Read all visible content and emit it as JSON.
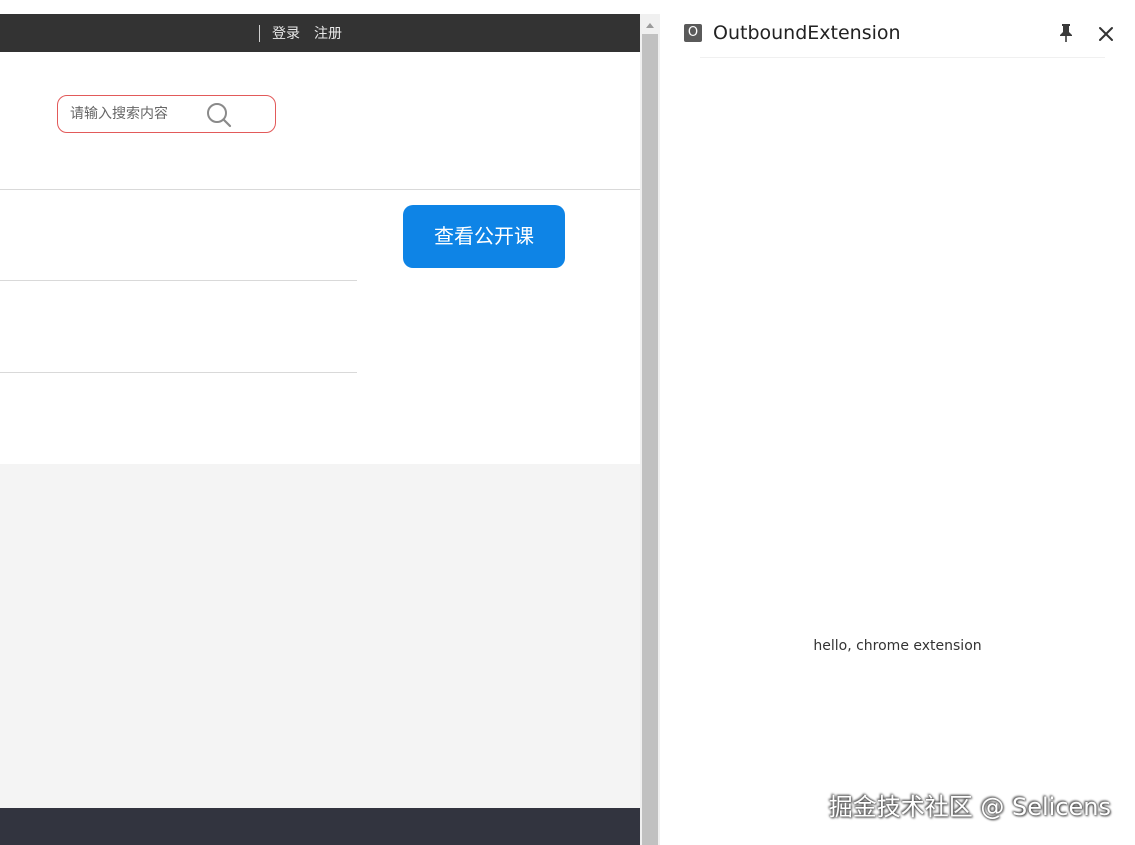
{
  "header": {
    "login_label": "登录",
    "register_label": "注册"
  },
  "search": {
    "placeholder": "请输入搜索内容"
  },
  "main": {
    "open_course_button_label": "查看公开课"
  },
  "side_panel": {
    "favicon_letter": "O",
    "title": "OutboundExtension",
    "message": "hello, chrome extension"
  },
  "watermark": "掘金技术社区 @ Selicens",
  "colors": {
    "topbar": "#333333",
    "accent_blue": "#0e84e6",
    "search_border": "#e25a5a",
    "grey_section": "#f4f4f4",
    "footer": "#32343f"
  },
  "icons": {
    "search": "search-icon",
    "pin": "pin-icon",
    "close": "close-icon"
  }
}
